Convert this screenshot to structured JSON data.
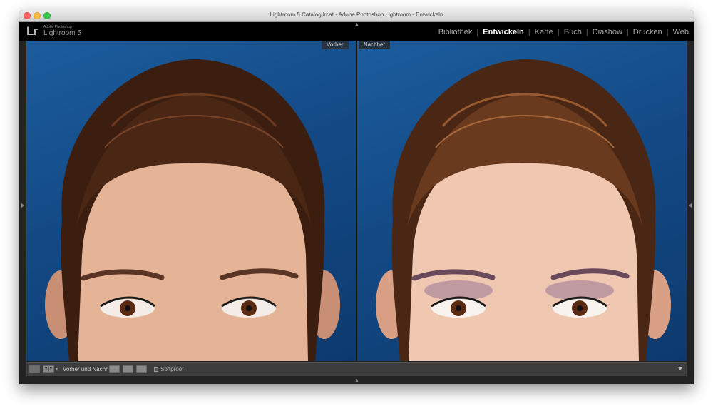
{
  "window": {
    "title": "Lightroom 5 Catalog.lrcat - Adobe Photoshop Lightroom - Entwickeln"
  },
  "identity": {
    "logo": "Lr",
    "company": "Adobe Photoshop",
    "product": "Lightroom 5"
  },
  "modules": [
    {
      "label": "Bibliothek",
      "active": false
    },
    {
      "label": "Entwickeln",
      "active": true
    },
    {
      "label": "Karte",
      "active": false
    },
    {
      "label": "Buch",
      "active": false
    },
    {
      "label": "Diashow",
      "active": false
    },
    {
      "label": "Drucken",
      "active": false
    },
    {
      "label": "Web",
      "active": false
    }
  ],
  "separator": "|",
  "view": {
    "before_label": "Vorher",
    "after_label": "Nachher"
  },
  "toolbar": {
    "view_toggle": "Y|Y",
    "before_after_label": "Vorher und Nachher:",
    "softproof_label": "Softproof"
  },
  "icons": {
    "collapse_top": "triangle-up",
    "collapse_bottom": "triangle-up",
    "panel_left": "triangle-right",
    "panel_right": "triangle-left",
    "toolbar_menu": "triangle-down"
  },
  "colors": {
    "background_blue": "#15508e",
    "hair": "#4a2614",
    "skin_before": "#e5b396",
    "skin_after": "#f0c7b0",
    "active_module": "#ffffff",
    "inactive_module": "#a8a8a8"
  }
}
